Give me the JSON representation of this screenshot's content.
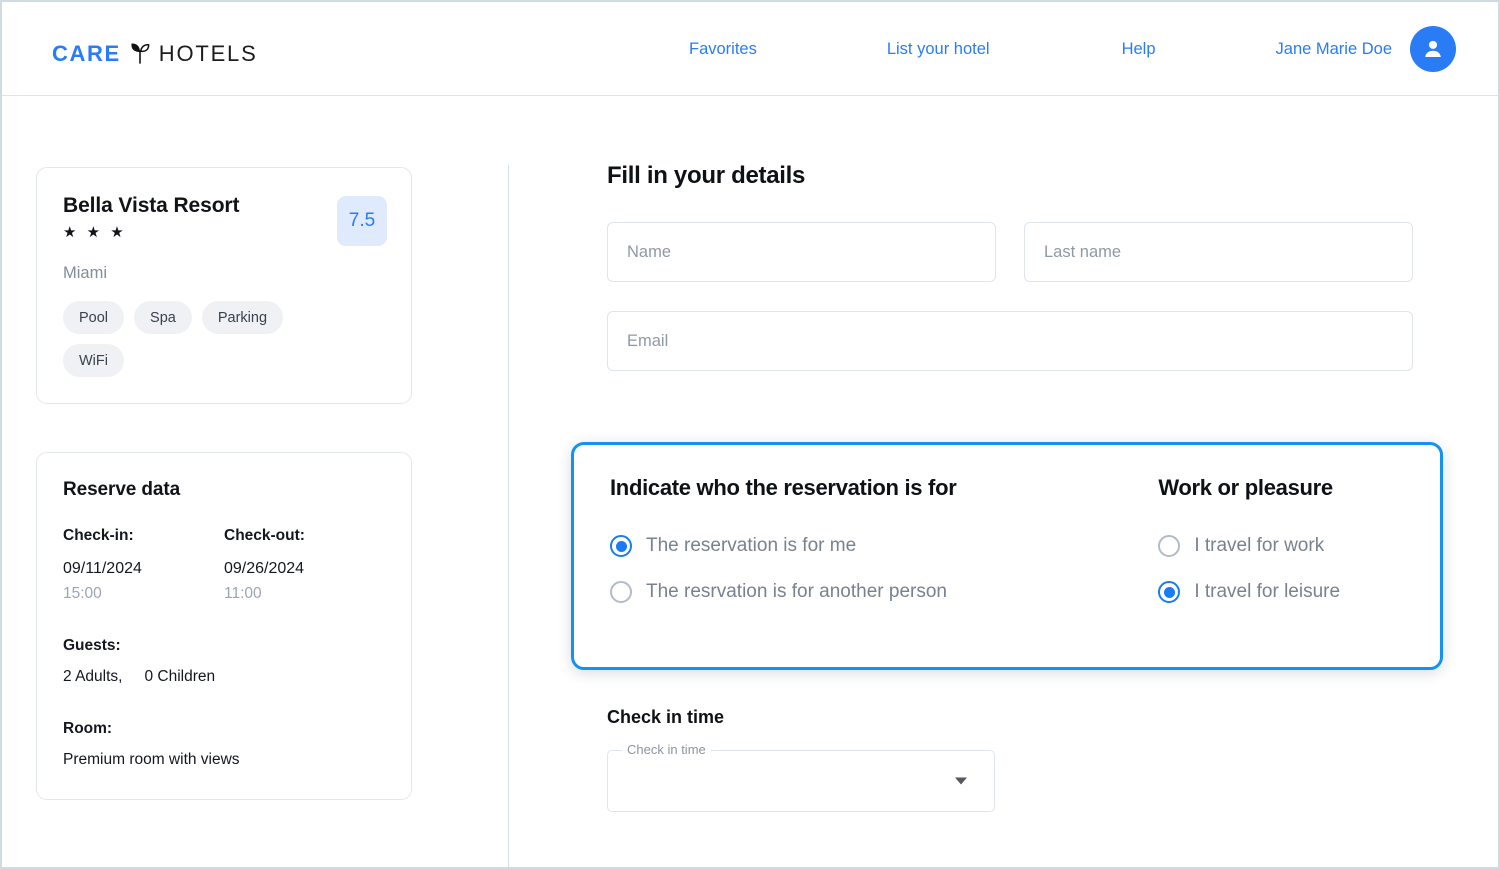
{
  "header": {
    "logo": {
      "care": "CARE",
      "hotels": "HOTELS",
      "mark": "sprout-leaf-icon"
    },
    "nav": [
      {
        "label": "Favorites",
        "name": "nav-favorites"
      },
      {
        "label": "List your hotel",
        "name": "nav-list-your-hotel"
      },
      {
        "label": "Help",
        "name": "nav-help"
      }
    ],
    "user_name": "Jane Marie Doe",
    "avatar_icon": "person-icon"
  },
  "hotel_card": {
    "name": "Bella Vista Resort",
    "stars": "★ ★ ★",
    "star_count": 3,
    "score": "7.5",
    "city": "Miami",
    "amenities": [
      "Pool",
      "Spa",
      "Parking",
      "WiFi"
    ]
  },
  "reserve_card": {
    "title": "Reserve data",
    "checkin_label": "Check-in:",
    "checkin_date": "09/11/2024",
    "checkin_time": "15:00",
    "checkout_label": "Check-out:",
    "checkout_date": "09/26/2024",
    "checkout_time": "11:00",
    "guests_label": "Guests:",
    "guests_adults": "2 Adults,",
    "guests_children": "0 Children",
    "room_label": "Room:",
    "room_value": "Premium room with views"
  },
  "form": {
    "title": "Fill in your details",
    "name_placeholder": "Name",
    "name_value": "",
    "lastname_placeholder": "Last name",
    "lastname_value": "",
    "email_placeholder": "Email",
    "email_value": ""
  },
  "highlight_panel": {
    "left_title": "Indicate who the reservation is for",
    "left_options": [
      {
        "label": "The reservation is for me",
        "selected": true
      },
      {
        "label": "The resrvation is for another person",
        "selected": false
      }
    ],
    "right_title": "Work or pleasure",
    "right_options": [
      {
        "label": "I travel for work",
        "selected": false
      },
      {
        "label": "I travel for leisure",
        "selected": true
      }
    ],
    "border_color": "#1492f0"
  },
  "checkin_time": {
    "heading": "Check in time",
    "field_label": "Check in time",
    "value": "",
    "caret_icon": "chevron-down-icon"
  },
  "colors": {
    "accent": "#2a7cf6",
    "highlight_border": "#1492f0",
    "badge_bg": "#dfeafd",
    "chip_bg": "#eff1f5",
    "muted_text": "#78828f"
  }
}
